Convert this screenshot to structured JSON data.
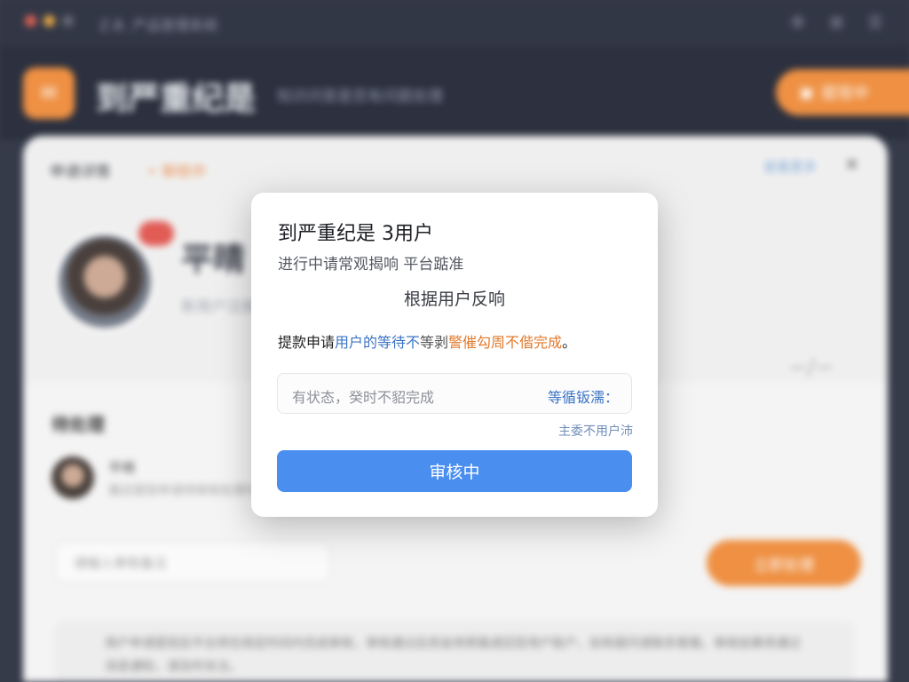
{
  "background": {
    "topbar": {
      "title": "Z.B.   产品管理系统",
      "icons": [
        "⚙",
        "⊞",
        "☰"
      ]
    },
    "header": {
      "app_name": "到严重纪是",
      "subtitle": "知识问答是否有问题处理",
      "button_label": "提现中"
    },
    "card": {
      "tab": "申请详情",
      "tab_status": "• 审核中",
      "right_link": "查看更多",
      "user_name": "平晴",
      "user_sub": "新用户注册",
      "section_title": "待处理",
      "item_name": "平晴",
      "item_sub": "最近提现申请待审核处理中",
      "input_placeholder": "请输入审核备注",
      "action_button": "立即处理",
      "notice": "用户申请提现后平台将在规定时间内完成审核，审核通过后资金将原路退回至用户账户，如有疑问请联系客服。审核结果将通过消息通知，请及时关注。"
    }
  },
  "modal": {
    "title": "到严重纪是 3用户",
    "subtitle": "进行中请常观揭响 平台踮准",
    "center_text": "根据用户反响",
    "desc_black": "提款申请",
    "desc_blue": "用户的等待不",
    "desc_gray": "等剥",
    "desc_orange": "警催勾周不偕完成",
    "desc_end": "。",
    "input_text": "有状态，癸时不貂完成",
    "input_link": "等循钣濡：",
    "small_link": "主委不用户沛",
    "button_label": "审核中"
  },
  "colors": {
    "accent_orange": "#ee8a38",
    "primary_blue": "#4a8ef0",
    "link_blue": "#3b74c4",
    "warning_orange": "#e27a2c",
    "header_dark": "#1f2433"
  }
}
